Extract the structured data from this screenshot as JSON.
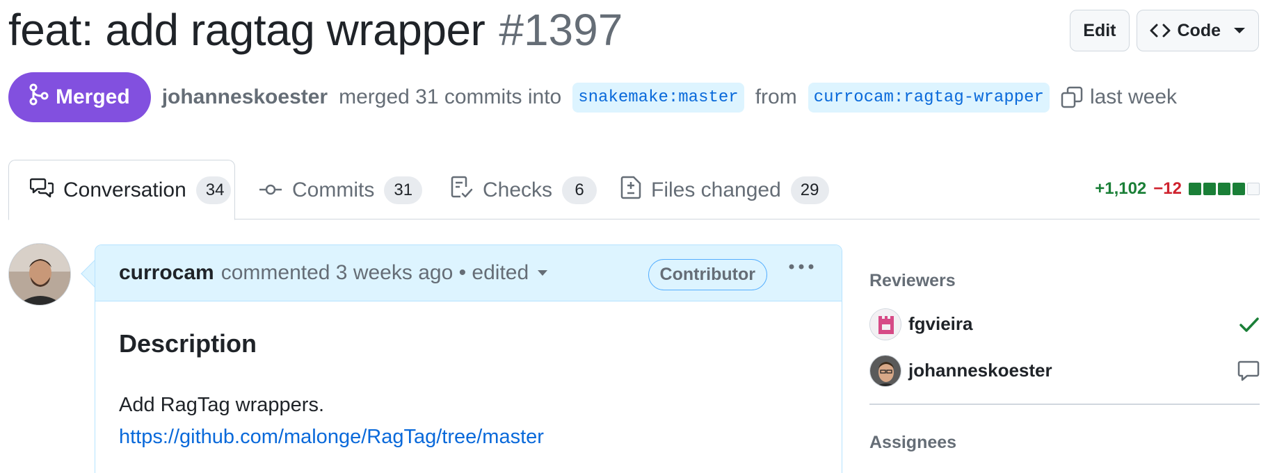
{
  "header": {
    "title": "feat: add ragtag wrapper",
    "number": "#1397",
    "edit_label": "Edit",
    "code_label": "Code"
  },
  "meta": {
    "state": "Merged",
    "author": "johanneskoester",
    "merged_text": "merged 31 commits into",
    "base_branch": "snakemake:master",
    "from_text": "from",
    "head_branch": "currocam:ragtag-wrapper",
    "time": "last week"
  },
  "tabs": [
    {
      "label": "Conversation",
      "count": "34",
      "icon": "comment-discussion-icon"
    },
    {
      "label": "Commits",
      "count": "31",
      "icon": "git-commit-icon"
    },
    {
      "label": "Checks",
      "count": "6",
      "icon": "checklist-icon"
    },
    {
      "label": "Files changed",
      "count": "29",
      "icon": "file-diff-icon"
    }
  ],
  "diffstat": {
    "additions": "+1,102",
    "deletions": "−12",
    "blocks": [
      "#1a7f37",
      "#1a7f37",
      "#1a7f37",
      "#1a7f37",
      "#f6f8fa"
    ]
  },
  "comment": {
    "author": "currocam",
    "action": "commented 3 weeks ago • edited",
    "role": "Contributor",
    "heading": "Description",
    "text": "Add RagTag wrappers.",
    "link": "https://github.com/malonge/RagTag/tree/master"
  },
  "sidebar": {
    "reviewers_heading": "Reviewers",
    "reviewers": [
      {
        "name": "fgvieira",
        "status": "approved-check-icon"
      },
      {
        "name": "johanneskoester",
        "status": "comment-icon"
      }
    ],
    "assignees_heading": "Assignees"
  },
  "colors": {
    "merged": "#8250df",
    "link": "#0969da",
    "branch_bg": "#ddf4ff",
    "comment_header_bg": "#ddf4ff",
    "approved": "#1a7f37",
    "deletions": "#cf222e"
  }
}
